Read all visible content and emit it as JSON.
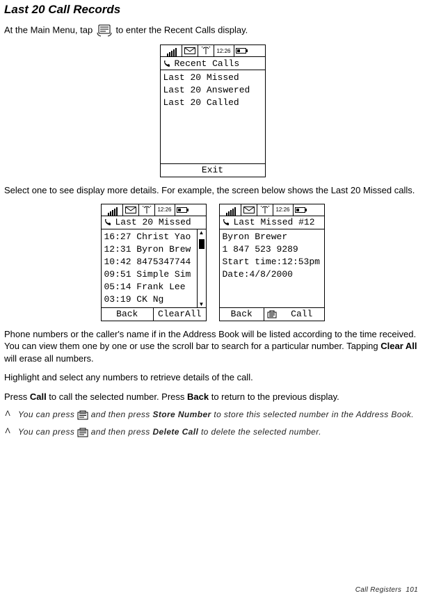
{
  "title": "Last 20 Call Records",
  "intro": {
    "before": "At the Main Menu, tap",
    "after": "to enter the Recent Calls display."
  },
  "recent_calls_screen": {
    "time": "12:26",
    "header": "Recent Calls",
    "items": [
      "Last 20 Missed",
      "Last 20 Answered",
      "Last 20 Called"
    ],
    "soft_center": "Exit"
  },
  "mid_para": "Select one to see display more details. For example, the screen below shows the Last 20 Missed calls.",
  "missed_list_screen": {
    "time": "12:26",
    "header": "Last 20 Missed",
    "rows": [
      "16:27 Christ Yao",
      "12:31 Byron Brew",
      "10:42 8475347744",
      "09:51 Simple Sim",
      "05:14 Frank Lee",
      "03:19 CK Ng"
    ],
    "soft_left": "Back",
    "soft_right": "ClearAll"
  },
  "missed_detail_screen": {
    "time": "12:26",
    "header": "Last Missed  #12",
    "lines": [
      "Byron Brewer",
      "1 847 523 9289",
      "Start time:12:53pm",
      "Date:4/8/2000"
    ],
    "soft_left": "Back",
    "soft_right": "Call"
  },
  "para2_parts": {
    "a": "Phone numbers or the caller's name if in the Address Book will be listed according to the time received. You can view them one by one or use the scroll bar to search for a particular number. Tapping ",
    "b": "Clear All",
    "c": " will erase all numbers."
  },
  "para3": "Highlight and select any numbers to retrieve details of the call.",
  "para4_parts": {
    "a": "Press ",
    "call": "Call",
    "b": " to call the selected number. Press ",
    "back": "Back",
    "c": " to return to the previous display."
  },
  "bullets": [
    {
      "marker": "Λ",
      "pre": "You can press ",
      "mid": " and then press ",
      "cmd": "Store Number",
      "post": " to store this selected number in the Address Book."
    },
    {
      "marker": "Λ",
      "pre": "You can press ",
      "mid": " and then press ",
      "cmd": "Delete Call",
      "post": " to delete the selected number."
    }
  ],
  "footer": {
    "section": "Call Registers",
    "page": "101"
  }
}
